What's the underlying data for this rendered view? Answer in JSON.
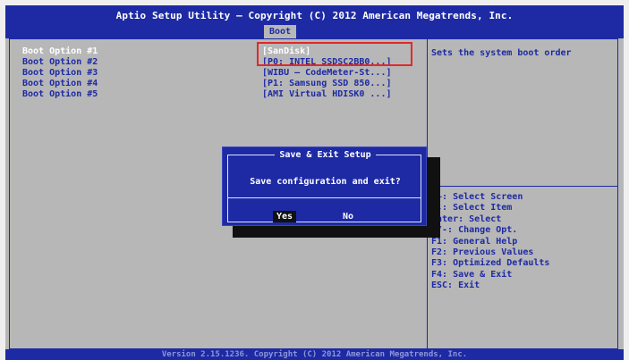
{
  "header": {
    "title": "Aptio Setup Utility – Copyright (C) 2012 American Megatrends, Inc.",
    "active_tab": "Boot"
  },
  "boot_options": [
    {
      "label": "Boot Option #1",
      "value": "[SanDisk]",
      "selected": true
    },
    {
      "label": "Boot Option #2",
      "value": "[P0: INTEL SSDSC2BB0...]",
      "selected": false
    },
    {
      "label": "Boot Option #3",
      "value": "[WIBU – CodeMeter-St...]",
      "selected": false
    },
    {
      "label": "Boot Option #4",
      "value": "[P1: Samsung SSD 850...]",
      "selected": false
    },
    {
      "label": "Boot Option #5",
      "value": "[AMI Virtual HDISK0 ...]",
      "selected": false
    }
  ],
  "help": {
    "description": "Sets the system boot order"
  },
  "keys": [
    "→←: Select Screen",
    "↑↓: Select Item",
    "Enter: Select",
    "+/-: Change Opt.",
    "F1: General Help",
    "F2: Previous Values",
    "F3: Optimized Defaults",
    "F4: Save & Exit",
    "ESC: Exit"
  ],
  "dialog": {
    "title": "Save & Exit Setup",
    "question": "Save configuration and exit?",
    "yes_label": "Yes",
    "no_label": "No"
  },
  "footer": {
    "text": "Version 2.15.1236. Copyright (C) 2012 American Megatrends, Inc."
  },
  "colors": {
    "bios_blue": "#1d2aa4",
    "bios_gray": "#b7b7b7",
    "highlight_red": "#e02a2a"
  }
}
